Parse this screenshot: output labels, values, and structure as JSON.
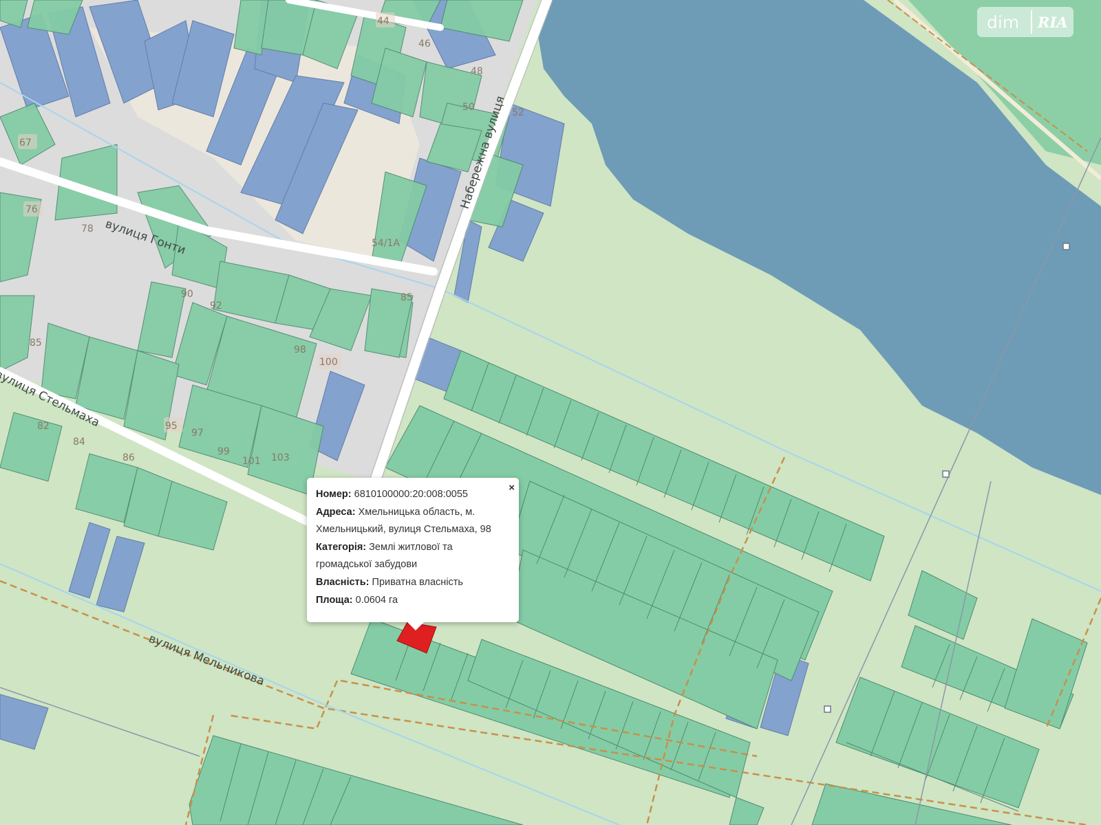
{
  "logo": {
    "primary": "dim",
    "secondary": "RIA"
  },
  "streets": [
    {
      "name": "Набережна вулиця"
    },
    {
      "name": "вулиця Гонти"
    },
    {
      "name": "вулиця Стельмаха"
    },
    {
      "name": "вулиця Мельникова"
    }
  ],
  "house_numbers": [
    "44",
    "46",
    "48",
    "50",
    "52",
    "54/1А",
    "67",
    "76",
    "78",
    "85",
    "85",
    "90",
    "92",
    "98",
    "100",
    "82",
    "84",
    "86",
    "95",
    "97",
    "99",
    "101",
    "103"
  ],
  "popup": {
    "close_symbol": "×",
    "number_label": "Номер:",
    "number_value": "6810100000:20:008:0055",
    "address_label": "Адреса:",
    "address_value_line1": "Хмельницька область, м.",
    "address_value_line2": "Хмельницький, вулиця Стельмаха, 98",
    "category_label": "Категорія:",
    "category_value_line1": "Землі житлової та",
    "category_value_line2": "громадської забудови",
    "ownership_label": "Власність:",
    "ownership_value": "Приватна власність",
    "area_label": "Площа:",
    "area_value": "0.0604 га"
  },
  "colors": {
    "background": "#cfe5c4",
    "water": "#6e9cb6",
    "parcel_green": "#84cca6",
    "parcel_blue": "#7f9fce",
    "selected_parcel": "#e02020",
    "road": "#ffffff",
    "built_area": "#dedede"
  }
}
